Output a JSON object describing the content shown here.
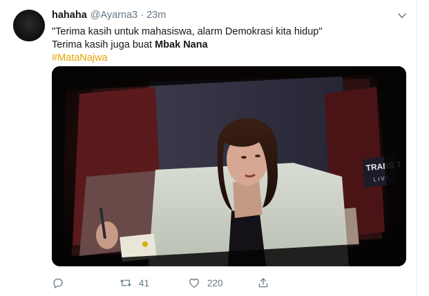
{
  "tweet": {
    "display_name": "hahaha",
    "handle": "@Ayarna3",
    "separator": "·",
    "time": "23m",
    "line1": "\"Terima kasih untuk mahasiswa, alarm Demokrasi kita hidup\"",
    "line2_prefix": "Terima kasih juga buat ",
    "line2_bold": "Mbak Nana",
    "hashtag": "#MataNajwa",
    "accent_color": "#e8a200",
    "media_logo_text": "TRANS 7",
    "media_logo_sub": "LIVE"
  },
  "actions": {
    "reply": {
      "icon": "reply-icon",
      "count": ""
    },
    "retweet": {
      "icon": "retweet-icon",
      "count": "41"
    },
    "like": {
      "icon": "heart-icon",
      "count": "220"
    },
    "share": {
      "icon": "share-icon",
      "count": ""
    }
  }
}
